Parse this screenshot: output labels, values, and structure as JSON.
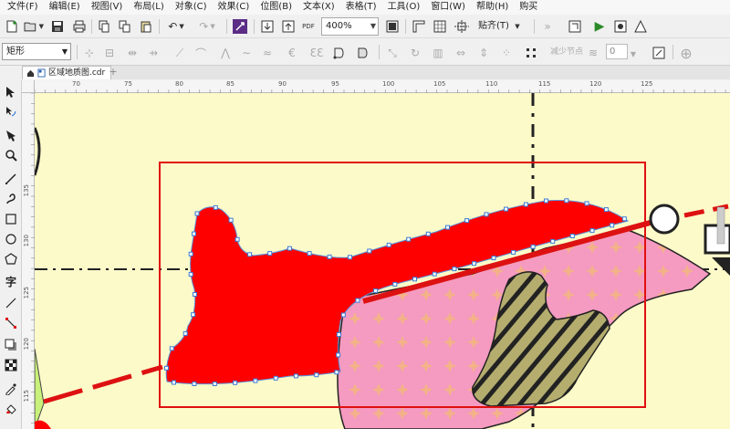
{
  "menu": [
    "文件(F)",
    "编辑(E)",
    "视图(V)",
    "布局(L)",
    "对象(C)",
    "效果(C)",
    "位图(B)",
    "文本(X)",
    "表格(T)",
    "工具(O)",
    "窗口(W)",
    "帮助(H)",
    "购买"
  ],
  "toolbar": {
    "zoom_value": "400%",
    "snap_label": "贴齐(T)"
  },
  "property_bar": {
    "shape_type": "矩形",
    "reduce_nodes_label": "减少节点",
    "curve_smoothness": "0"
  },
  "document_tab": {
    "title": "区域地质图.cdr"
  },
  "ruler": {
    "horizontal_ticks": [
      "70",
      "75",
      "80",
      "85",
      "90",
      "95",
      "100",
      "105",
      "110",
      "115",
      "120",
      "125"
    ],
    "vertical_ticks": [
      "135",
      "130",
      "125",
      "120",
      "115"
    ]
  },
  "canvas": {
    "background_color": "#fdfac9",
    "red_fill_color": "#ff0000",
    "pink_fill_color": "#f59ac0",
    "hatch_fill_color": "#b4ad6e",
    "selection_box_color": "#e01010",
    "node_color": "#3a7bd5"
  }
}
